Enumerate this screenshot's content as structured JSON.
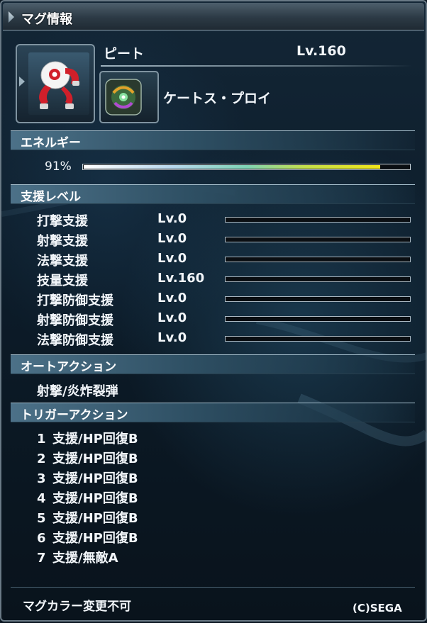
{
  "window": {
    "title": "マグ情報"
  },
  "mag": {
    "name": "ピート",
    "level": "Lv.160",
    "portrait_icon": "red-white-mag-icon",
    "photon_blast_icon": "photon-blast-icon",
    "photon_blast_name": "ケートス・プロイ"
  },
  "energy": {
    "heading": "エネルギー",
    "percent_text": "91%",
    "value": 0.91
  },
  "support": {
    "heading": "支援レベル",
    "rows": [
      {
        "label": "打撃支援",
        "level": "Lv.0",
        "value": 0
      },
      {
        "label": "射撃支援",
        "level": "Lv.0",
        "value": 0
      },
      {
        "label": "法撃支援",
        "level": "Lv.0",
        "value": 0
      },
      {
        "label": "技量支援",
        "level": "Lv.160",
        "value": 0
      },
      {
        "label": "打撃防御支援",
        "level": "Lv.0",
        "value": 0
      },
      {
        "label": "射撃防御支援",
        "level": "Lv.0",
        "value": 0
      },
      {
        "label": "法撃防御支援",
        "level": "Lv.0",
        "value": 0
      }
    ]
  },
  "auto_action": {
    "heading": "オートアクション",
    "value": "射撃/炎炸裂弾"
  },
  "trigger_action": {
    "heading": "トリガーアクション",
    "items": [
      {
        "num": "1",
        "text": "支援/HP回復B"
      },
      {
        "num": "2",
        "text": "支援/HP回復B"
      },
      {
        "num": "3",
        "text": "支援/HP回復B"
      },
      {
        "num": "4",
        "text": "支援/HP回復B"
      },
      {
        "num": "5",
        "text": "支援/HP回復B"
      },
      {
        "num": "6",
        "text": "支援/HP回復B"
      },
      {
        "num": "7",
        "text": "支援/無敵A"
      }
    ]
  },
  "footer": {
    "note": "マグカラー変更不可",
    "copyright": "(C)SEGA"
  },
  "colors": {
    "energy_end": "#f1e51a",
    "section_band": "#4c7188",
    "frame": "#6a7a86"
  }
}
